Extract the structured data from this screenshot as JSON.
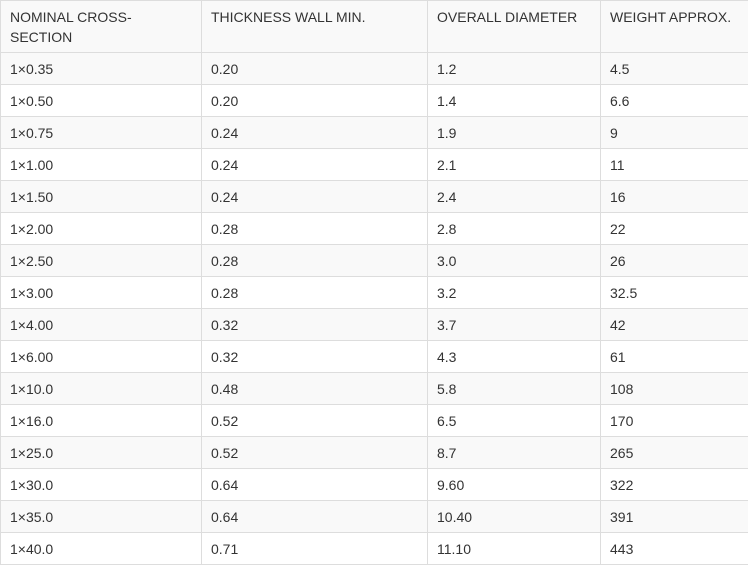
{
  "table": {
    "headers": [
      "NOMINAL CROSS-SECTION",
      "THICKNESS WALL MIN.",
      "OVERALL DIAMETER",
      "WEIGHT APPROX."
    ],
    "rows": [
      [
        "1×0.35",
        "0.20",
        "1.2",
        "4.5"
      ],
      [
        "1×0.50",
        "0.20",
        "1.4",
        "6.6"
      ],
      [
        "1×0.75",
        "0.24",
        "1.9",
        "9"
      ],
      [
        "1×1.00",
        "0.24",
        "2.1",
        "11"
      ],
      [
        "1×1.50",
        "0.24",
        "2.4",
        "16"
      ],
      [
        "1×2.00",
        "0.28",
        "2.8",
        "22"
      ],
      [
        "1×2.50",
        "0.28",
        "3.0",
        "26"
      ],
      [
        "1×3.00",
        "0.28",
        "3.2",
        "32.5"
      ],
      [
        "1×4.00",
        "0.32",
        "3.7",
        "42"
      ],
      [
        "1×6.00",
        "0.32",
        "4.3",
        "61"
      ],
      [
        "1×10.0",
        "0.48",
        "5.8",
        "108"
      ],
      [
        "1×16.0",
        "0.52",
        "6.5",
        "170"
      ],
      [
        "1×25.0",
        "0.52",
        "8.7",
        "265"
      ],
      [
        "1×30.0",
        "0.64",
        "9.60",
        "322"
      ],
      [
        "1×35.0",
        "0.64",
        "10.40",
        "391"
      ],
      [
        "1×40.0",
        "0.71",
        "11.10",
        "443"
      ]
    ]
  }
}
